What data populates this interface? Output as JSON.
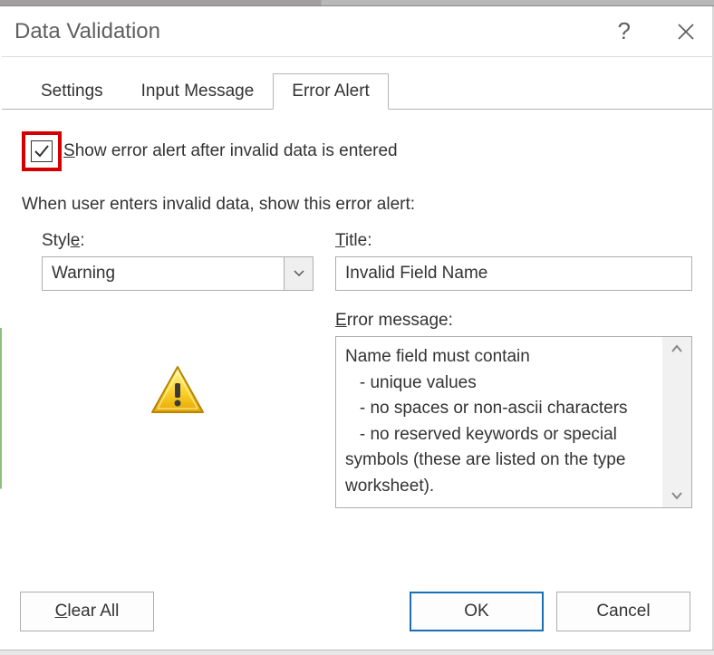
{
  "dialog": {
    "title": "Data Validation",
    "help_symbol": "?"
  },
  "tabs": [
    {
      "label": "Settings"
    },
    {
      "label": "Input Message"
    },
    {
      "label": "Error Alert"
    }
  ],
  "checkbox": {
    "label_pre": "S",
    "label_post": "how error alert after invalid data is entered",
    "checked": true
  },
  "section_label": "When user enters invalid data, show this error alert:",
  "style_field": {
    "label_pre": "Styl",
    "label_under": "e",
    "label_post": ":",
    "value": "Warning"
  },
  "title_field": {
    "label_under": "T",
    "label_post": "itle:",
    "value": "Invalid Field Name"
  },
  "error_message_field": {
    "label_under": "E",
    "label_post": "rror message:",
    "value": "Name field must contain\n   - unique values\n   - no spaces or non-ascii characters\n   - no reserved keywords or special symbols (these are listed on the type worksheet)."
  },
  "buttons": {
    "clear_all_under": "C",
    "clear_all_post": "lear All",
    "ok": "OK",
    "cancel": "Cancel"
  }
}
